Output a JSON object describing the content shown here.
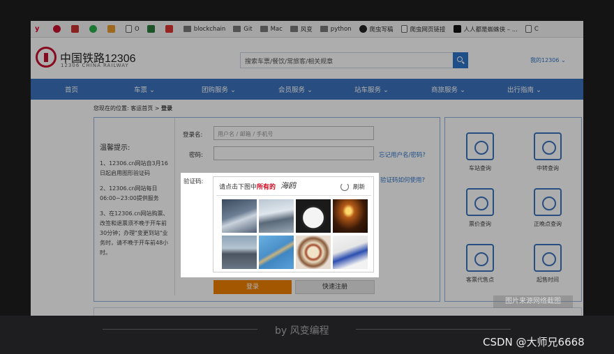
{
  "bookmarks": [
    {
      "icon": "y-icon",
      "label": ""
    },
    {
      "icon": "pinterest-icon",
      "label": ""
    },
    {
      "icon": "b-icon",
      "label": ""
    },
    {
      "icon": "wechat-icon",
      "label": ""
    },
    {
      "icon": "app-icon",
      "label": ""
    },
    {
      "icon": "page-icon",
      "label": "O"
    },
    {
      "icon": "sheet-icon",
      "label": ""
    },
    {
      "icon": "red-app-icon",
      "label": ""
    },
    {
      "icon": "folder-icon",
      "label": "blockchain"
    },
    {
      "icon": "folder-icon",
      "label": "Git"
    },
    {
      "icon": "folder-icon",
      "label": "Mac"
    },
    {
      "icon": "folder-icon",
      "label": "风变"
    },
    {
      "icon": "folder-icon",
      "label": "python"
    },
    {
      "icon": "github-icon",
      "label": "爬虫写稿"
    },
    {
      "icon": "page-icon",
      "label": "爬虫网页链接"
    },
    {
      "icon": "dark-app-icon",
      "label": "人人都是蜘蛛侠 – ..."
    },
    {
      "icon": "page-icon",
      "label": "C"
    }
  ],
  "header": {
    "logo_title": "中国铁路12306",
    "logo_sub": "12306 CHINA RAILWAY",
    "search_placeholder": "搜索车票/餐饮/常旅客/相关规章",
    "my_account": "我的12306 ⌄"
  },
  "nav": [
    "首页",
    "车票 ⌄",
    "团购服务 ⌄",
    "会员服务 ⌄",
    "站车服务 ⌄",
    "商旅服务 ⌄",
    "出行指南 ⌄"
  ],
  "breadcrumb": {
    "prefix": "您现在的位置:",
    "home": "客运首页",
    "sep": ">",
    "current": "登录"
  },
  "tips": {
    "title": "温馨提示:",
    "items": [
      "1、12306.cn网站自3月16日起启用图形验证码",
      "2、12306.cn网站每日06:00~23:00提供服务",
      "3、在12306.cn网站购票、改签和退票须不晚于开车前30分钟；办理\"变更到站\"业务时，请不晚于开车前48小时。"
    ]
  },
  "form": {
    "username_label": "登录名:",
    "username_placeholder": "用户名 / 邮箱 / 手机号",
    "password_label": "密码:",
    "forgot_link": "忘记用户名/密码?",
    "captcha_label": "验证码:",
    "captcha_help_link": "验证码如何使用?",
    "login_button": "登录",
    "register_button": "快速注册"
  },
  "captcha": {
    "prompt_before": "请点击下图中",
    "prompt_highlight": "所有的",
    "prompt_word": "海鸥",
    "refresh": "刷新",
    "images": [
      "seagull-photo",
      "seagull-photo",
      "rice-cooker-photo",
      "candle-photo",
      "ship-photo",
      "chopsticks-photo",
      "food-plate-photo",
      "wine-bottles-photo"
    ]
  },
  "services": [
    "车站查询",
    "中转查询",
    "票价查询",
    "正晚点查询",
    "客票代售点",
    "起售时间"
  ],
  "watermark": "图片来源网络截图",
  "footer": "by 风变编程",
  "csdn": "CSDN @大师兄6668"
}
